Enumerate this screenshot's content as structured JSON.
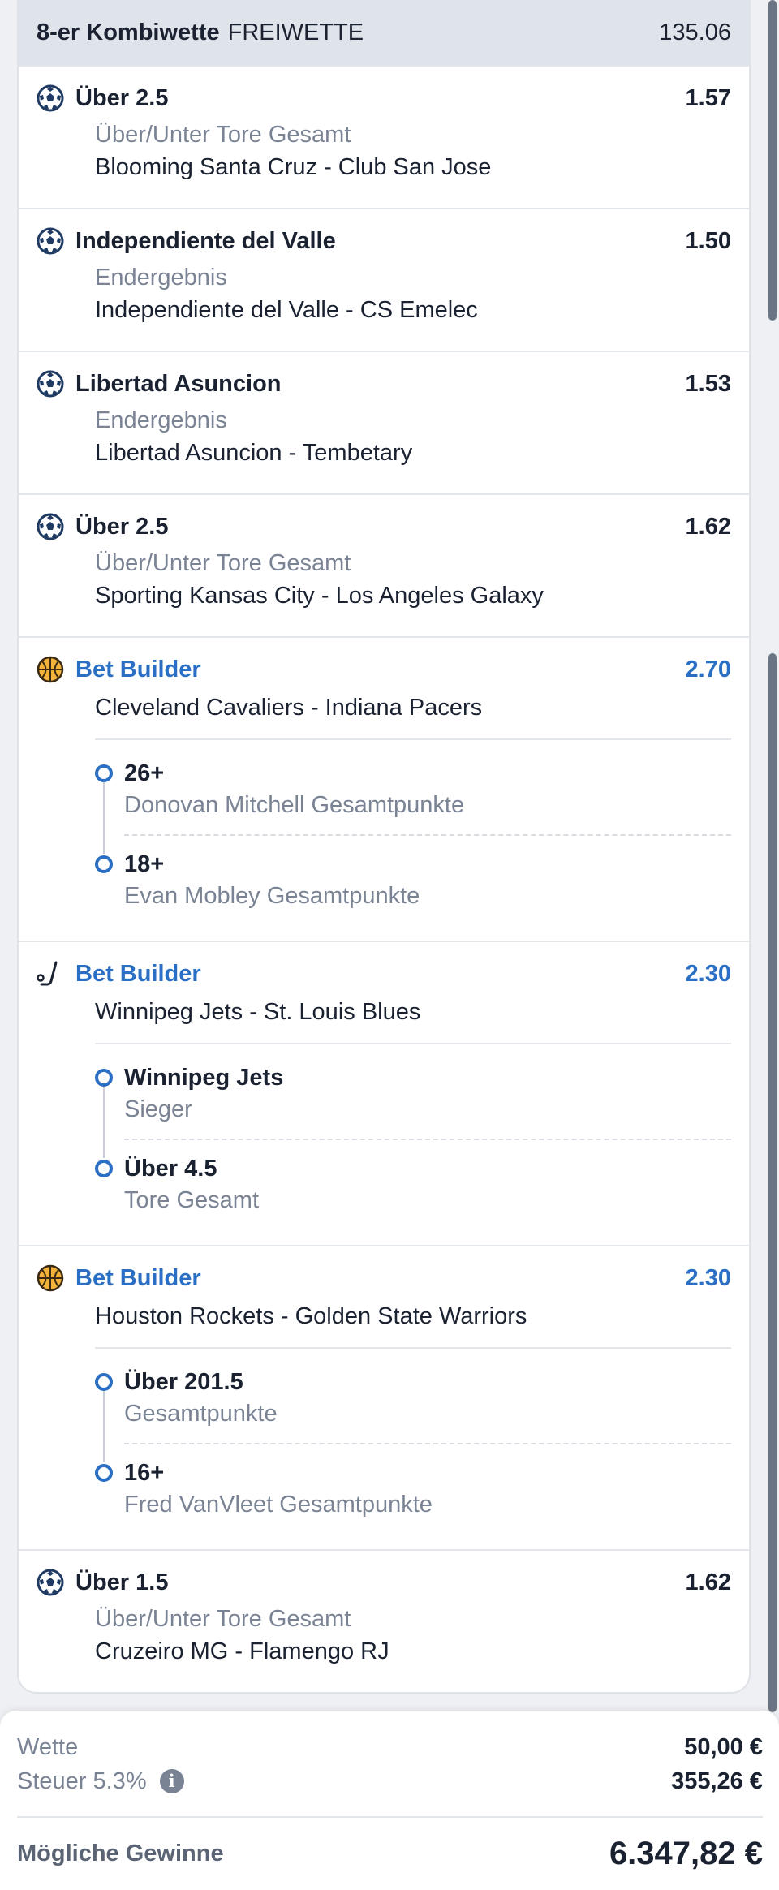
{
  "header": {
    "title": "8-er Kombiwette",
    "tag": "FREIWETTE",
    "total_odds": "135.06"
  },
  "legs": [
    {
      "sport": "soccer-icon",
      "selection": "Über 2.5",
      "odds": "1.57",
      "market": "Über/Unter Tore Gesamt",
      "event": "Blooming Santa Cruz - Club San Jose"
    },
    {
      "sport": "soccer-icon",
      "selection": "Independiente del Valle",
      "odds": "1.50",
      "market": "Endergebnis",
      "event": "Independiente del Valle - CS Emelec"
    },
    {
      "sport": "soccer-icon",
      "selection": "Libertad Asuncion",
      "odds": "1.53",
      "market": "Endergebnis",
      "event": "Libertad Asuncion - Tembetary"
    },
    {
      "sport": "soccer-icon",
      "selection": "Über 2.5",
      "odds": "1.62",
      "market": "Über/Unter Tore Gesamt",
      "event": "Sporting Kansas City - Los Angeles Galaxy"
    },
    {
      "sport": "basketball-icon",
      "selection": "Bet Builder",
      "odds": "2.70",
      "event": "Cleveland Cavaliers - Indiana Pacers",
      "sub": [
        {
          "name": "26+",
          "desc": "Donovan Mitchell Gesamtpunkte"
        },
        {
          "name": "18+",
          "desc": "Evan Mobley Gesamtpunkte"
        }
      ]
    },
    {
      "sport": "hockey-icon",
      "selection": "Bet Builder",
      "odds": "2.30",
      "event": "Winnipeg Jets - St. Louis Blues",
      "sub": [
        {
          "name": "Winnipeg Jets",
          "desc": "Sieger"
        },
        {
          "name": "Über 4.5",
          "desc": "Tore Gesamt"
        }
      ]
    },
    {
      "sport": "basketball-icon",
      "selection": "Bet Builder",
      "odds": "2.30",
      "event": "Houston Rockets - Golden State Warriors",
      "sub": [
        {
          "name": "Über 201.5",
          "desc": "Gesamtpunkte"
        },
        {
          "name": "16+",
          "desc": "Fred VanVleet Gesamtpunkte"
        }
      ]
    },
    {
      "sport": "soccer-icon",
      "selection": "Über 1.5",
      "odds": "1.62",
      "market": "Über/Unter Tore Gesamt",
      "event": "Cruzeiro MG - Flamengo RJ"
    }
  ],
  "footer": {
    "stake_label": "Wette",
    "stake_value": "50,00 €",
    "tax_label": "Steuer 5.3%",
    "tax_value": "355,26 €",
    "info_glyph": "i",
    "winnings_label": "Mögliche Gewinne",
    "winnings_value": "6.347,82 €"
  },
  "colors": {
    "accent": "#2a6fc4",
    "header_bg": "#dfe3ea",
    "text": "#1a2130",
    "muted": "#7a8394"
  }
}
